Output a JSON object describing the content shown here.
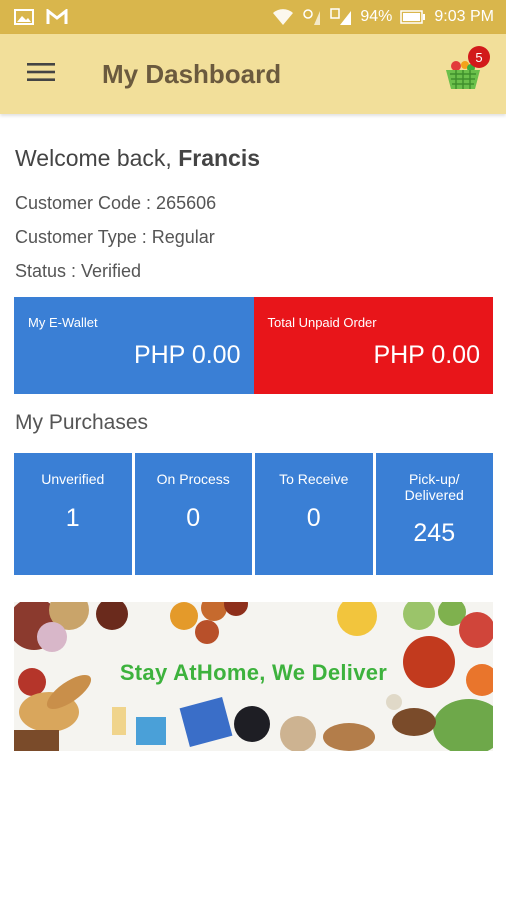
{
  "status_bar": {
    "battery": "94%",
    "time": "9:03 PM"
  },
  "app_bar": {
    "title": "My Dashboard",
    "cart_count": "5"
  },
  "welcome": {
    "greeting": "Welcome back,",
    "name": "Francis"
  },
  "customer": {
    "code_line": "Customer Code : 265606",
    "type_line": "Customer Type : Regular",
    "status_line": "Status : Verified"
  },
  "wallet": {
    "ewallet_label": "My E-Wallet",
    "ewallet_amount": "PHP 0.00",
    "unpaid_label": "Total Unpaid Order",
    "unpaid_amount": "PHP 0.00"
  },
  "purchases": {
    "title": "My Purchases",
    "tiles": [
      {
        "label": "Unverified",
        "value": "1"
      },
      {
        "label": "On Process",
        "value": "0"
      },
      {
        "label": "To Receive",
        "value": "0"
      },
      {
        "label_line1": "Pick-up/",
        "label_line2": "Delivered",
        "value": "245"
      }
    ]
  },
  "banner": {
    "text": "Stay AtHome, We Deliver"
  },
  "colors": {
    "status_bar": "#d9b64c",
    "app_bar": "#f2df9a",
    "tile_blue": "#3a7fd5",
    "tile_red": "#e8151a",
    "banner_text": "#3db23d"
  }
}
